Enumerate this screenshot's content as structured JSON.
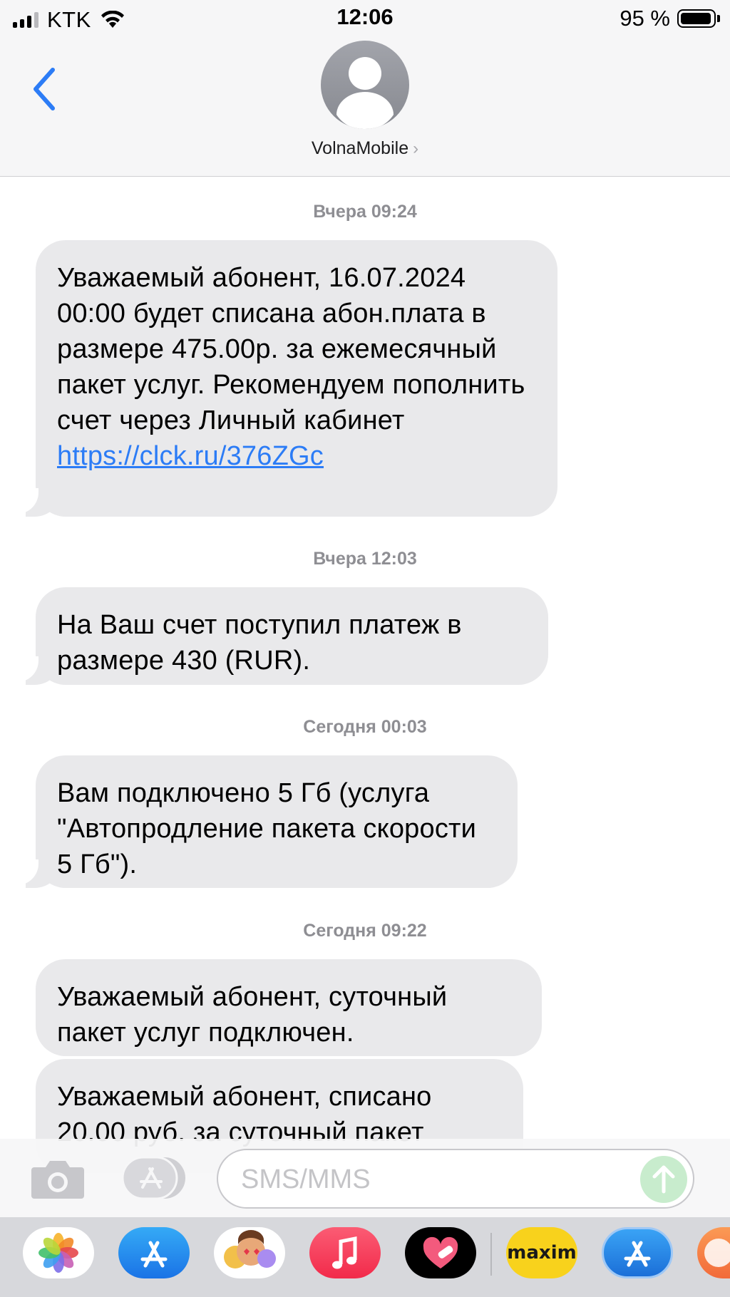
{
  "status_bar": {
    "carrier": "KTK",
    "time": "12:06",
    "battery_percent": "95 %",
    "battery_level": 0.95,
    "signal_bars": 3,
    "signal_bars_total": 4
  },
  "header": {
    "back_icon": "chevron-left-icon",
    "avatar_icon": "person-silhouette-icon",
    "contact_name": "VolnaMobile",
    "contact_chevron": "›"
  },
  "messages": [
    {
      "timestamp": "Вчера 09:24",
      "text": "Уважаемый абонент, 16.07.2024 00:00 будет списана абон.плата в размере 475.00р. за ежемесячный пакет услуг. Рекомендуем пополнить счет через Личный кабинет ",
      "link": "https://clck.ru/376ZGc"
    },
    {
      "timestamp": "Вчера 12:03",
      "text": "На Ваш счет поступил платеж в размере 430 (RUR)."
    },
    {
      "timestamp": "Сегодня 00:03",
      "text": "Вам подключено 5 Гб (услуга \"Автопродление пакета скорости 5 Гб\")."
    },
    {
      "timestamp": "Сегодня 09:22",
      "text": "Уважаемый абонент, суточный пакет услуг подключен."
    },
    {
      "text": "Уважаемый абонент, списано 20.00 руб. за суточный пакет"
    }
  ],
  "input_bar": {
    "camera_icon": "camera-icon",
    "apps_icon": "app-store-icon",
    "placeholder": "SMS/MMS",
    "value": "",
    "send_icon": "arrow-up-icon"
  },
  "app_drawer": {
    "apps": [
      {
        "name": "photos-icon"
      },
      {
        "name": "app-store-icon"
      },
      {
        "name": "memoji-icon"
      },
      {
        "name": "music-icon"
      },
      {
        "name": "heart-app-icon"
      },
      {
        "label": "maxim"
      },
      {
        "name": "app-store-icon"
      },
      {
        "name": "partial-app-icon"
      }
    ]
  },
  "colors": {
    "bubble": "#e9e9eb",
    "link": "#2c7cf6",
    "accent": "#2c7cf6",
    "timestamp": "#8e8e93"
  }
}
